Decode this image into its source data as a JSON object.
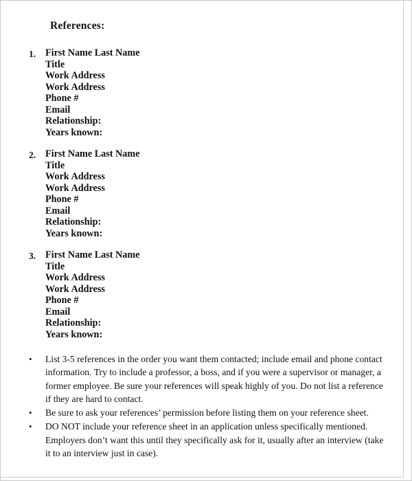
{
  "document": {
    "title": "References:",
    "bullet_glyph": "•"
  },
  "references": [
    {
      "number": "1.",
      "lines": [
        "First Name Last Name",
        "Title",
        "Work Address",
        "Work Address",
        "Phone #",
        "Email",
        "Relationship:",
        "Years known:"
      ]
    },
    {
      "number": "2.",
      "lines": [
        "First Name Last Name",
        "Title",
        "Work Address",
        "Work Address",
        "Phone #",
        "Email",
        "Relationship:",
        "Years known:"
      ]
    },
    {
      "number": "3.",
      "lines": [
        "First Name Last Name",
        "Title",
        "Work Address",
        "Work Address",
        "Phone #",
        "Email",
        "Relationship:",
        "Years known:"
      ]
    }
  ],
  "tips": [
    "List 3-5 references in the order you want them contacted; include email and phone contact information. Try to include a professor, a boss, and if you were a supervisor or manager, a former employee. Be sure your references will speak highly of you. Do not list a reference if they are hard to contact.",
    "Be sure to ask your references’ permission before listing them on your reference sheet.",
    "DO NOT include your reference sheet in an application unless specifically mentioned. Employers don’t want this until they specifically ask for it, usually after an interview (take it to an interview just in case)."
  ],
  "colors": {
    "text": "#111111",
    "page_background": "#ffffff",
    "page_border": "#c9c9c9"
  }
}
